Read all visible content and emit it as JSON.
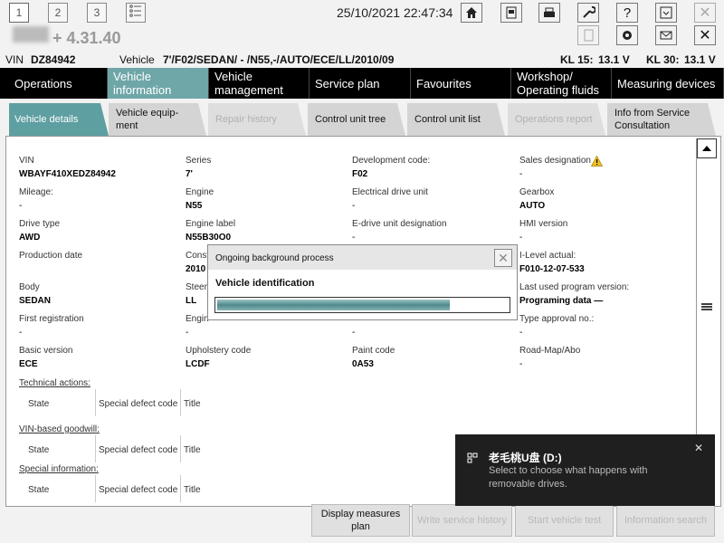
{
  "toolbar": {
    "window_buttons": [
      "1",
      "2",
      "3"
    ],
    "datetime": "25/10/2021 22:47:34",
    "version": "+ 4.31.40"
  },
  "vehicle_bar": {
    "vin_label": "VIN",
    "vin_value": "DZ84942",
    "vehicle_label": "Vehicle",
    "vehicle_value": "7'/F02/SEDAN/ - /N55,-/AUTO/ECE/LL/2010/09",
    "kl15_label": "KL 15:",
    "kl15_value": "13.1 V",
    "kl30_label": "KL 30:",
    "kl30_value": "13.1 V"
  },
  "main_nav": [
    {
      "label": "Operations"
    },
    {
      "label": "Vehicle information"
    },
    {
      "label": "Vehicle management"
    },
    {
      "label": "Service plan"
    },
    {
      "label": "Favourites"
    },
    {
      "label": "Workshop/ Operating fluids"
    },
    {
      "label": "Measuring devices"
    }
  ],
  "sub_tabs": [
    {
      "label": "Vehicle details"
    },
    {
      "label": "Vehicle equip- ment"
    },
    {
      "label": "Repair history"
    },
    {
      "label": "Control unit tree"
    },
    {
      "label": "Control unit list"
    },
    {
      "label": "Operations report"
    },
    {
      "label": "Info from Service Consultation"
    }
  ],
  "details": {
    "vin": {
      "label": "VIN",
      "value": "WBAYF410XEDZ84942"
    },
    "series": {
      "label": "Series",
      "value": "7'"
    },
    "dev_code": {
      "label": "Development code:",
      "value": "F02"
    },
    "sales": {
      "label": "Sales designation",
      "value": "-"
    },
    "mileage": {
      "label": "Mileage:",
      "value": "-"
    },
    "engine": {
      "label": "Engine",
      "value": "N55"
    },
    "edrive": {
      "label": "Electrical drive unit",
      "value": "-"
    },
    "gearbox": {
      "label": "Gearbox",
      "value": "AUTO"
    },
    "drive_type": {
      "label": "Drive type",
      "value": "AWD"
    },
    "engine_label": {
      "label": "Engine label",
      "value": "N55B30O0"
    },
    "edrive_desig": {
      "label": "E-drive unit designation",
      "value": "-"
    },
    "hmi": {
      "label": "HMI version",
      "value": "-"
    },
    "prod_date": {
      "label": "Production date"
    },
    "const": {
      "label": "Const",
      "value": "2010"
    },
    "ilevel": {
      "label": "I-Level actual:",
      "value": "F010-12-07-533"
    },
    "body": {
      "label": "Body",
      "value": "SEDAN"
    },
    "steer": {
      "label": "Steer",
      "value": "LL"
    },
    "last_prog": {
      "label": "Last used program version:",
      "value": "Programing data —"
    },
    "first_reg": {
      "label": "First registration",
      "value": "-"
    },
    "engin2": {
      "label": "Engin",
      "value": "-"
    },
    "col3_row6": {
      "value": "-"
    },
    "type_approval": {
      "label": "Type approval no.:",
      "value": "-"
    },
    "basic": {
      "label": "Basic version",
      "value": "ECE"
    },
    "upholstery": {
      "label": "Upholstery code",
      "value": "LCDF"
    },
    "paint": {
      "label": "Paint code",
      "value": "0A53"
    },
    "roadmap": {
      "label": "Road-Map/Abo",
      "value": "-"
    }
  },
  "sections": {
    "technical": "Technical actions:",
    "vin_goodwill": "VIN-based goodwill:",
    "special": "Special information:",
    "col_state": "State",
    "col_defect": "Special defect code",
    "col_title": "Title"
  },
  "dialog": {
    "title": "Ongoing background process",
    "message": "Vehicle identification",
    "progress": 0.8
  },
  "bottom_buttons": [
    {
      "label": "Display measures plan"
    },
    {
      "label": "Write service history"
    },
    {
      "label": "Start vehicle test"
    },
    {
      "label": "Information search"
    }
  ],
  "toast": {
    "title": "老毛桃U盘 (D:)",
    "line1": "Select to choose what happens with",
    "line2": "removable drives."
  },
  "colors": {
    "accent": "#6fa6a8",
    "nav_bg": "#000000",
    "toast_bg": "#1f1f1f"
  }
}
